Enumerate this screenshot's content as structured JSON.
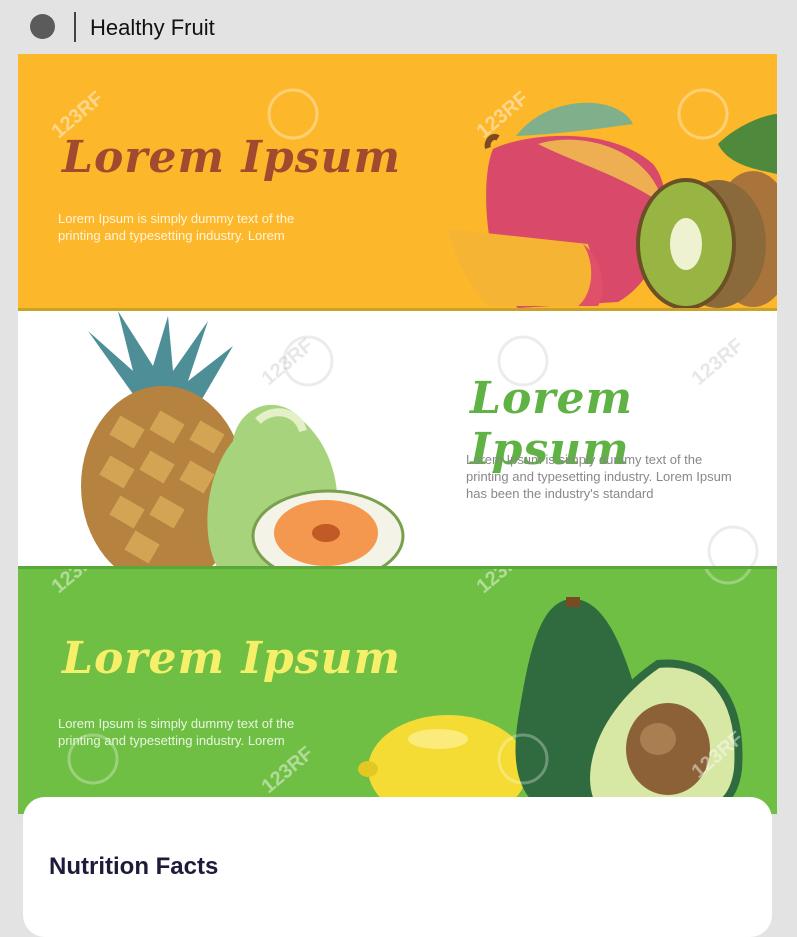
{
  "app": {
    "title": "Healthy Fruit"
  },
  "banners": [
    {
      "heading": "Lorem Ipsum",
      "body": "Lorem Ipsum is simply dummy text of the printing and typesetting industry. Lorem"
    },
    {
      "heading": "Lorem Ipsum",
      "body": "Lorem Ipsum is simply dummy text of the printing and typesetting industry. Lorem Ipsum has been the industry's standard"
    },
    {
      "heading": "Lorem Ipsum",
      "body": "Lorem Ipsum is simply dummy text of the printing and typesetting industry. Lorem"
    }
  ],
  "watermark": "123RF",
  "nutrition": {
    "title": "Nutrition Facts"
  },
  "colors": {
    "orange": "#fdb72b",
    "green": "#6fbf44",
    "white": "#ffffff"
  }
}
